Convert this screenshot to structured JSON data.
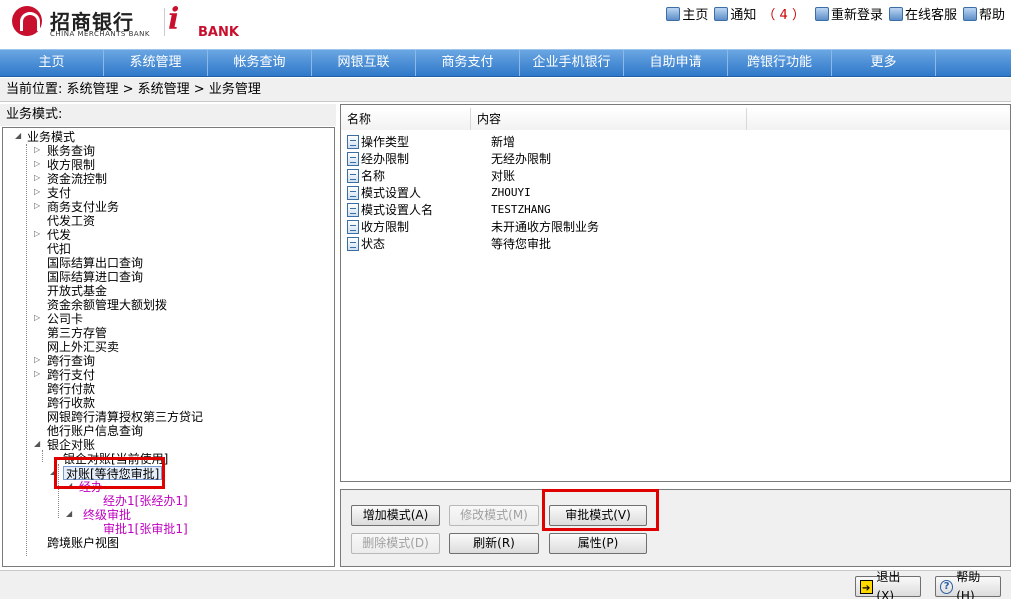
{
  "header": {
    "bank_name_cn": "招商银行",
    "bank_name_en": "CHINA MERCHANTS BANK",
    "ibank_letter": "i",
    "ibank_text": "BANK",
    "links": {
      "home": "主页",
      "notify": "通知",
      "notify_count": "（ 4 ）",
      "relogin": "重新登录",
      "service": "在线客服",
      "help": "帮助"
    }
  },
  "nav": {
    "items": [
      "主页",
      "系统管理",
      "帐务查询",
      "网银互联",
      "商务支付",
      "企业手机银行",
      "自助申请",
      "跨银行功能",
      "更多"
    ]
  },
  "breadcrumb": "当前位置: 系统管理 > 系统管理 > 业务管理",
  "left": {
    "label": "业务模式:",
    "tree": {
      "root": "业务模式",
      "items": [
        "账务查询",
        "收方限制",
        "资金流控制",
        "支付",
        "商务支付业务",
        "代发工资",
        "代发",
        "代扣",
        "国际结算出口查询",
        "国际结算进口查询",
        "开放式基金",
        "资金余额管理大额划拨",
        "公司卡",
        "第三方存管",
        "网上外汇买卖",
        "跨行查询",
        "跨行支付",
        "跨行付款",
        "跨行收款",
        "网银跨行清算授权第三方贷记",
        "他行账户信息查询"
      ],
      "bank_recon": "银企对账",
      "bank_recon_child": "银企对账[当前使用]",
      "recon_selected": "对账[等待您审批]",
      "level_handle": "经办",
      "handler": "经办1[张经办1]",
      "level_final": "终级审批",
      "approver": "审批1[张审批1]",
      "cross_border": "跨境账户视图"
    }
  },
  "table": {
    "col_name": "名称",
    "col_content": "内容",
    "rows": [
      {
        "name": "操作类型",
        "value": "新增"
      },
      {
        "name": "经办限制",
        "value": "无经办限制"
      },
      {
        "name": "名称",
        "value": "对账"
      },
      {
        "name": "模式设置人",
        "value": "ZHOUYI"
      },
      {
        "name": "模式设置人名",
        "value": "TESTZHANG"
      },
      {
        "name": "收方限制",
        "value": "未开通收方限制业务"
      },
      {
        "name": "状态",
        "value": "等待您审批"
      }
    ]
  },
  "buttons": {
    "add": "增加模式(A)",
    "modify": "修改模式(M)",
    "approve": "审批模式(V)",
    "delete": "删除模式(D)",
    "refresh": "刷新(R)",
    "props": "属性(P)"
  },
  "footer": {
    "exit": "退出(X)",
    "help": "帮助(H)"
  },
  "colors": {
    "nav_top": "#6aa6e3",
    "nav_bottom": "#2f78c9",
    "brand_red": "#c8102e",
    "highlight_red": "#e00000",
    "purple": "#c000c0"
  }
}
